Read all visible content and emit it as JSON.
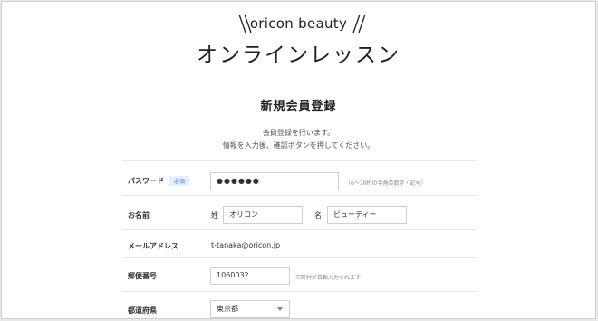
{
  "header": {
    "brand": "oricon beauty",
    "subtitle": "オンラインレッスン"
  },
  "page": {
    "title": "新規会員登録",
    "intro_line1": "会員登録を行います。",
    "intro_line2": "情報を入力後、確認ボタンを押してください。"
  },
  "form": {
    "password": {
      "label": "パスワード",
      "badge": "必須",
      "value": "●●●●●●",
      "hint": "（6～30桁の半角英数字・記号）"
    },
    "name": {
      "label": "お名前",
      "last_label": "姓",
      "last_value": "オリコン",
      "first_label": "名",
      "first_value": "ビューティー"
    },
    "email": {
      "label": "メールアドレス",
      "value": "t-tanaka@oricon.jp"
    },
    "postal": {
      "label": "郵便番号",
      "value": "1060032",
      "hint": "市町村が自動入力されます"
    },
    "prefecture": {
      "label": "都道府県",
      "value": "東京都"
    }
  }
}
